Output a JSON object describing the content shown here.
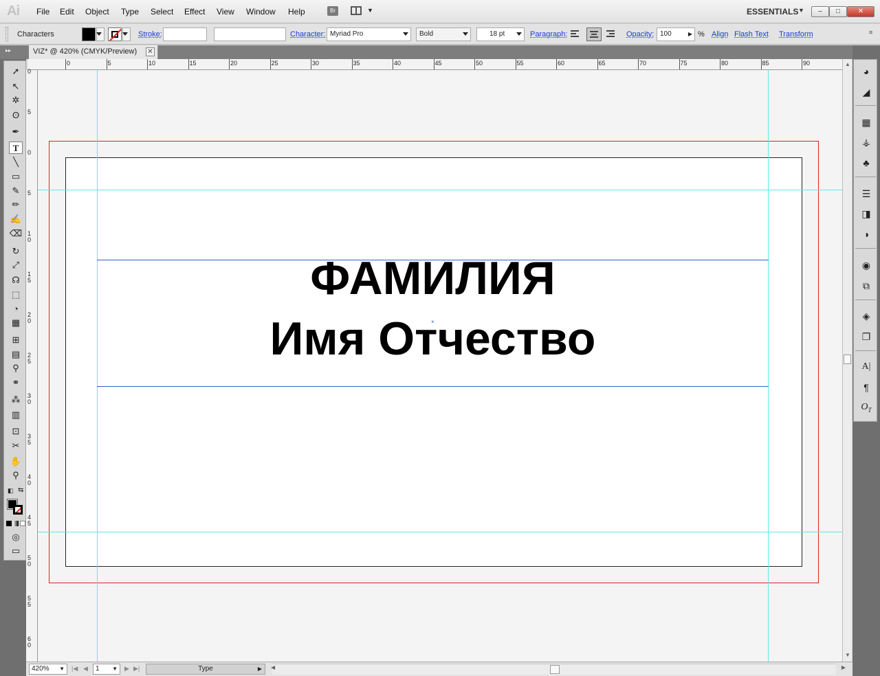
{
  "app": {
    "logo": "Ai",
    "workspace": "ESSENTIALS",
    "bridge_label": "Br"
  },
  "menu": [
    "File",
    "Edit",
    "Object",
    "Type",
    "Select",
    "Effect",
    "View",
    "Window",
    "Help"
  ],
  "window_controls": {
    "minimize": "–",
    "restore": "□",
    "close": "✕"
  },
  "control_bar": {
    "panel_label": "Characters",
    "fill_color": "#000000",
    "stroke_label": "Stroke:",
    "stroke_value": "",
    "stroke_style": "",
    "character_label": "Character:",
    "font_family": "Myriad Pro",
    "font_style": "Bold",
    "font_size": "18 pt",
    "paragraph_label": "Paragraph:",
    "opacity_label": "Opacity:",
    "opacity_value": "100",
    "opacity_unit": "%",
    "align_link": "Align",
    "flash_text_link": "Flash Text",
    "transform_link": "Transform"
  },
  "document": {
    "tab_title": "VIZ* @ 420% (CMYK/Preview)",
    "close_glyph": "✕"
  },
  "ruler": {
    "top_ticks": [
      "0",
      "5",
      "10",
      "15",
      "20",
      "25",
      "30",
      "35",
      "40",
      "45",
      "50",
      "55",
      "60",
      "65",
      "70",
      "75",
      "80",
      "85",
      "90"
    ],
    "left_ticks": [
      "0",
      "5",
      "0",
      "5",
      "1\n0",
      "1\n5",
      "2\n0",
      "2\n5",
      "3\n0",
      "3\n5",
      "4\n0",
      "4\n5",
      "5\n0",
      "5\n5",
      "6\n0"
    ]
  },
  "artboard_text": {
    "line1": "ФАМИЛИЯ",
    "line2": "Имя Отчество"
  },
  "status_bar": {
    "zoom": "420%",
    "page": "1",
    "tool": "Type"
  },
  "colors": {
    "bleed": "#e02020",
    "guide": "#5fe8ec",
    "text_frame": "#2f5fd0",
    "panel_dark": "#6f6f6f"
  },
  "tools": [
    "selection-tool",
    "direct-selection-tool",
    "magic-wand-tool",
    "lasso-tool",
    "pen-tool",
    "type-tool",
    "line-tool",
    "rectangle-tool",
    "paintbrush-tool",
    "pencil-tool",
    "blob-brush-tool",
    "eraser-tool",
    "rotate-tool",
    "scale-tool",
    "warp-tool",
    "free-transform-tool",
    "shape-builder-tool",
    "perspective-grid-tool",
    "mesh-tool",
    "gradient-tool",
    "eyedropper-tool",
    "blend-tool",
    "symbol-sprayer-tool",
    "column-graph-tool",
    "artboard-tool",
    "slice-tool",
    "hand-tool",
    "zoom-tool"
  ],
  "dock": [
    "color-panel",
    "color-guide-panel",
    "swatches-panel",
    "brushes-panel",
    "symbols-panel",
    "stroke-panel",
    "gradient-panel",
    "transparency-panel",
    "appearance-panel",
    "graphic-styles-panel",
    "layers-panel",
    "artboards-panel",
    "character-panel",
    "paragraph-panel",
    "opentype-panel"
  ]
}
